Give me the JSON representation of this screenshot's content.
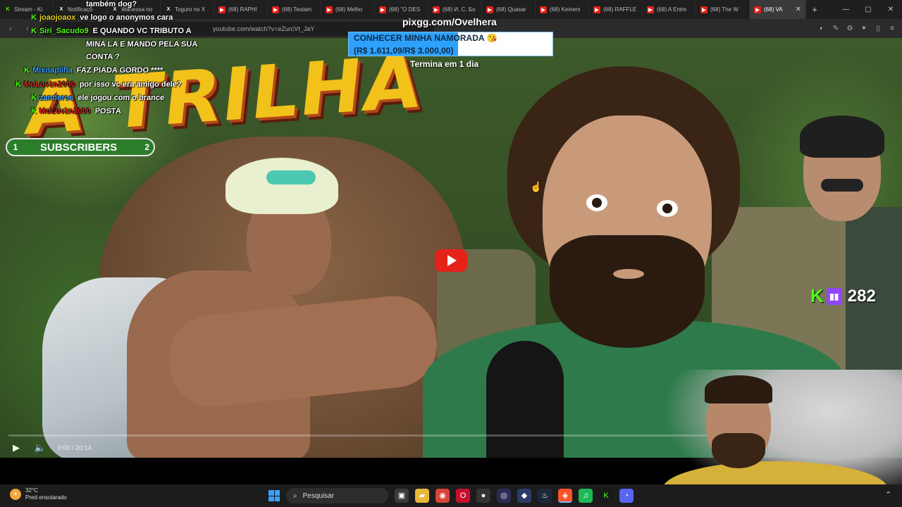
{
  "browser": {
    "tabs": [
      {
        "label": "Stream - Ki",
        "icon": "kick-icon",
        "active": false
      },
      {
        "label": "Notificaçõ",
        "icon": "x-icon",
        "active": false
      },
      {
        "label": "Wanessa no",
        "icon": "x-icon",
        "active": false
      },
      {
        "label": "Toguro no X",
        "icon": "x-icon",
        "active": false
      },
      {
        "label": "(68) RAPHI",
        "icon": "youtube-icon",
        "active": false
      },
      {
        "label": "(68) Testam",
        "icon": "youtube-icon",
        "active": false
      },
      {
        "label": "(68) Melho",
        "icon": "youtube-icon",
        "active": false
      },
      {
        "label": "(68) \"O DES",
        "icon": "youtube-icon",
        "active": false
      },
      {
        "label": "(68) И. С. Бо",
        "icon": "youtube-icon",
        "active": false
      },
      {
        "label": "(68) Quasar",
        "icon": "youtube-icon",
        "active": false
      },
      {
        "label": "(68) Keinem",
        "icon": "youtube-icon",
        "active": false
      },
      {
        "label": "(68) RAFFLE",
        "icon": "youtube-icon",
        "active": false
      },
      {
        "label": "(68) A Entre",
        "icon": "youtube-icon",
        "active": false
      },
      {
        "label": "(68) The W",
        "icon": "youtube-icon",
        "active": false
      },
      {
        "label": "(68) VA",
        "icon": "youtube-icon",
        "active": true
      }
    ],
    "url": "youtube.com/watch?v=eZurcVt_JaY"
  },
  "video": {
    "thumbnail_title": "A TRILHA",
    "time_display": "0:00 / 20:14"
  },
  "overlay": {
    "chat": [
      {
        "user": "",
        "message": "também dog?",
        "user_color": "#ffffff",
        "badge": false
      },
      {
        "user": "joaojoaox",
        "message": "ve logo o anonymos cara",
        "user_color": "#e8d21f",
        "badge": true
      },
      {
        "user": "Siri_Sacudo9",
        "message": "E QUANDO VC TRIBUTO A",
        "user_color": "#53fc18",
        "badge": true
      },
      {
        "user": "",
        "message": "MINA LA E MANDO PELA SUA",
        "user_color": "#ffffff",
        "badge": false
      },
      {
        "user": "",
        "message": "CONTA ?",
        "user_color": "#ffffff",
        "badge": false
      },
      {
        "user": "Mixnapilha",
        "message": "FAZ PIADA GORDO ****",
        "user_color": "#3aa0ff",
        "badge": true
      },
      {
        "user": "MoLov1n2000",
        "message": "por isso vc era amigo dele?",
        "user_color": "#e02020",
        "badge": true
      },
      {
        "user": "zanderos",
        "message": "ele jogou com o brance",
        "user_color": "#3aa0ff",
        "badge": true
      },
      {
        "user": "MoLov1n2000",
        "message": "POSTA",
        "user_color": "#e02020",
        "badge": true
      }
    ],
    "donation_url": "pixgg.com/Ovelhera",
    "goal": {
      "title": "CONHECER MINHA NAMORADA 😘",
      "amount": "(R$ 1.611,09/R$ 3.000,00)",
      "ends": "Termina em 1 dia",
      "progress_fraction": 0.537,
      "fill_color": "#2ea1ff"
    },
    "subscribers": {
      "current": "1",
      "label": "SUBSCRIBERS",
      "target": "2"
    },
    "viewers": {
      "count": "282",
      "kick_color": "#53fc18",
      "twitch_color": "#9146ff"
    }
  },
  "taskbar": {
    "weather_temp": "32°C",
    "weather_desc": "Pred ensolarado",
    "search_placeholder": "Pesquisar",
    "apps": [
      "task-view-icon",
      "file-explorer-icon",
      "chrome-icon",
      "opera-icon",
      "record-icon",
      "obs-icon",
      "arc-icon",
      "steam-icon",
      "brave-icon",
      "spotify-icon",
      "kick-icon",
      "discord-icon"
    ]
  }
}
